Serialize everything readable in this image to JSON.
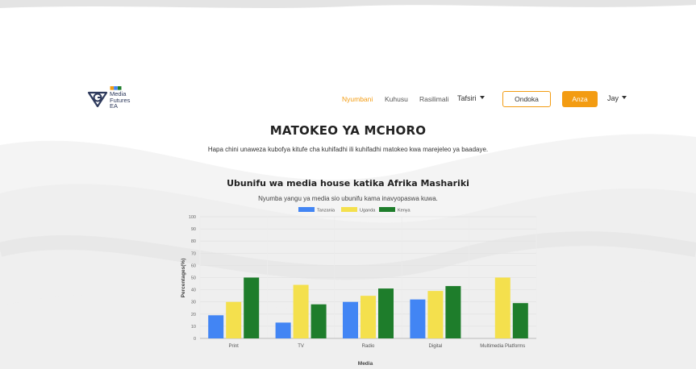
{
  "brand": {
    "logo_text_line1": "Media",
    "logo_text_line2": "Futures",
    "logo_text_line3": "EA"
  },
  "nav": {
    "links": [
      "Nyumbani",
      "Kuhusu",
      "Rasilimali"
    ],
    "active_link": "Nyumbani",
    "translate_label": "Tafsiri",
    "logout_label": "Ondoka",
    "start_label": "Anza",
    "user_label": "Jay"
  },
  "main": {
    "title": "MATOKEO YA MCHORO",
    "subtitle": "Hapa chini unaweza kubofya kitufe cha kuhifadhi ili kuhifadhi matokeo kwa marejeleo ya baadaye.",
    "chart_title": "Ubunifu wa media house katika Afrika Mashariki",
    "chart_subtitle": "Nyumba yangu ya media sio ubunifu kama inavyopaswa kuwa."
  },
  "colors": {
    "accent": "#f39c12",
    "tanzania": "#4285f4",
    "uganda": "#f4e04d",
    "kenya": "#1e7d2b"
  },
  "chart_data": {
    "type": "bar",
    "categories": [
      "Print",
      "TV",
      "Radio",
      "Digital",
      "Multimedia Platforms"
    ],
    "series": [
      {
        "name": "Tanzania",
        "values": [
          19,
          13,
          30,
          32,
          0
        ]
      },
      {
        "name": "Uganda",
        "values": [
          30,
          44,
          35,
          39,
          50
        ]
      },
      {
        "name": "Kenya",
        "values": [
          50,
          28,
          41,
          43,
          29
        ]
      }
    ],
    "ylim": [
      0,
      100
    ],
    "yticks": [
      0,
      10,
      20,
      30,
      40,
      50,
      60,
      70,
      80,
      90,
      100
    ],
    "xlabel": "Media",
    "ylabel": "Percentages(%)",
    "grid": true,
    "legend_position": "top"
  }
}
